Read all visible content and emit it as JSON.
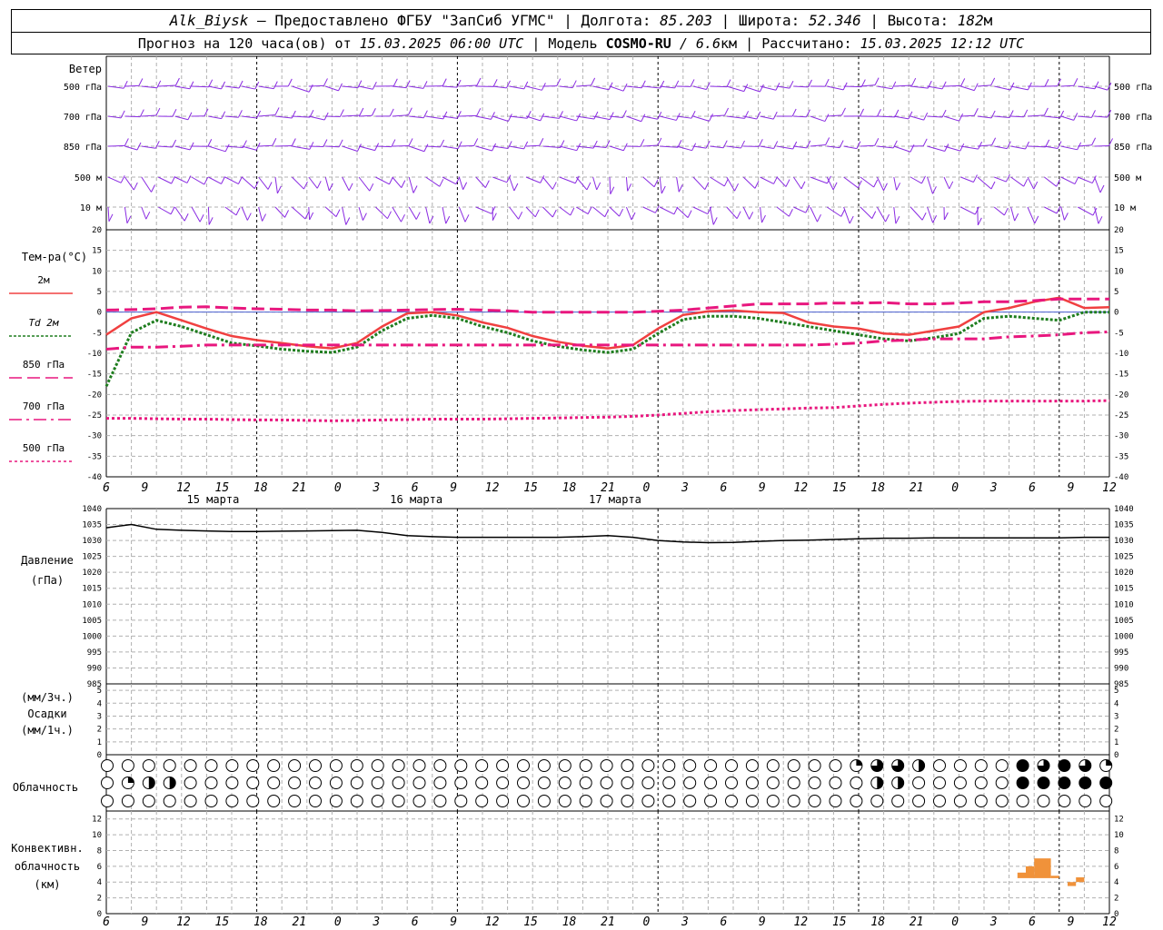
{
  "header": {
    "station": "Alk_Biysk",
    "provider": "— Предоставлено ФГБУ \"ЗапСиб УГМС\"",
    "lon_label": "Долгота:",
    "lon_value": "85.203",
    "lat_label": "Широта:",
    "lat_value": "52.346",
    "alt_label": "Высота:",
    "alt_value": "182",
    "alt_unit": "м",
    "forecast_label": "Прогноз на 120 часа(ов) от",
    "forecast_start": "15.03.2025 06:00 UTC",
    "model_label": "Модель",
    "model_name": "COSMO-RU",
    "model_res": "/ 6.6",
    "model_res_unit": "км",
    "computed_label": "Рассчитано:",
    "computed_time": "15.03.2025 12:12 UTC"
  },
  "wind": {
    "title": "Ветер",
    "levels": [
      "500 гПа",
      "700 гПа",
      "850 гПа",
      "500 м",
      "10 м"
    ],
    "color": "#8a2be2"
  },
  "temperature": {
    "title": "Тем-ра(°C)",
    "legend": [
      {
        "label": "2м",
        "color": "#f04040",
        "style": "solid"
      },
      {
        "label": "Td  2м",
        "color": "#1e7d1e",
        "style": "dotted"
      },
      {
        "label": "850 гПа",
        "color": "#e8177e",
        "style": "dash"
      },
      {
        "label": "700 гПа",
        "color": "#e8177e",
        "style": "dashdot"
      },
      {
        "label": "500 гПа",
        "color": "#e8177e",
        "style": "dot"
      }
    ],
    "y_ticks": [
      20,
      15,
      10,
      5,
      0,
      -5,
      -10,
      -15,
      -20,
      -25,
      -30,
      -35,
      -40
    ]
  },
  "time_axis": {
    "hour_labels": [
      "6",
      "9",
      "12",
      "15",
      "18",
      "21",
      "0",
      "3",
      "6",
      "9",
      "12",
      "15",
      "18",
      "21",
      "0",
      "3",
      "6",
      "9",
      "12",
      "15",
      "18",
      "21",
      "0",
      "3",
      "6",
      "9",
      "12"
    ],
    "day_labels": [
      "15 марта",
      "16 марта",
      "17 марта"
    ]
  },
  "pressure": {
    "title": "Давление",
    "unit": "(гПа)",
    "y_ticks": [
      1040,
      1035,
      1030,
      1025,
      1020,
      1015,
      1010,
      1005,
      1000,
      995,
      990,
      985
    ]
  },
  "precip": {
    "unit_top": "(мм/3ч.)",
    "title": "Осадки",
    "unit_bottom": "(мм/1ч.)",
    "y_ticks": [
      5,
      4,
      3,
      2,
      1,
      0
    ]
  },
  "cloud": {
    "title": "Облачность"
  },
  "convective": {
    "title_1": "Конвективн.",
    "title_2": "облачность",
    "unit": "(км)",
    "y_ticks": [
      12,
      10,
      8,
      6,
      4,
      2,
      0
    ],
    "color": "#f0923a"
  },
  "chart_data": [
    {
      "type": "line",
      "title": "Тем-ра(°C)",
      "x_hours": [
        0,
        3,
        6,
        9,
        12,
        15,
        18,
        21,
        24,
        27,
        30,
        33,
        36,
        39,
        42,
        45,
        48,
        51,
        54,
        57,
        60,
        63,
        66,
        69,
        72,
        75,
        78,
        81,
        84,
        87,
        90,
        93,
        96,
        99,
        102,
        105,
        108,
        111,
        114,
        117,
        120
      ],
      "ylim": [
        -40,
        20
      ],
      "series": [
        {
          "name": "2м",
          "values": [
            -5.5,
            -1.5,
            0,
            -2,
            -4,
            -5.8,
            -6.8,
            -7.5,
            -8.3,
            -8.8,
            -7.5,
            -3.5,
            -0.3,
            0,
            -0.8,
            -2.5,
            -3.8,
            -5.8,
            -7.2,
            -8.2,
            -8.8,
            -8,
            -4,
            -0.7,
            0.2,
            0.4,
            0,
            -0.2,
            -2.5,
            -3.5,
            -4,
            -5.2,
            -5.5,
            -4.5,
            -3.5,
            0,
            1,
            2.5,
            3.5,
            1,
            1.2
          ]
        },
        {
          "name": "Td  2м",
          "values": [
            -18,
            -5,
            -2,
            -3.5,
            -5.5,
            -7.5,
            -8.2,
            -9,
            -9.5,
            -9.8,
            -8.5,
            -4.5,
            -1.5,
            -0.8,
            -1.5,
            -3.5,
            -5,
            -7,
            -8.3,
            -9.2,
            -9.8,
            -9,
            -5.2,
            -1.8,
            -1,
            -1,
            -1.5,
            -2.5,
            -3.5,
            -4.5,
            -5.5,
            -6.5,
            -7,
            -6.2,
            -5.2,
            -1.5,
            -1,
            -1.5,
            -2,
            0,
            0
          ]
        },
        {
          "name": "850 гПа",
          "values": [
            0.5,
            0.6,
            0.8,
            1.2,
            1.3,
            1,
            0.8,
            0.7,
            0.5,
            0.5,
            0.3,
            0.4,
            0.5,
            0.6,
            0.7,
            0.5,
            0.3,
            0,
            0,
            0,
            0,
            0,
            0.2,
            0.5,
            1,
            1.5,
            2,
            2,
            2,
            2.2,
            2.2,
            2.3,
            2,
            2,
            2.2,
            2.5,
            2.5,
            2.8,
            3.2,
            3.2,
            3.2
          ]
        },
        {
          "name": "700 гПа",
          "values": [
            -9,
            -8.5,
            -8.5,
            -8.3,
            -8,
            -8,
            -8,
            -8,
            -8,
            -8,
            -8,
            -8,
            -8,
            -8,
            -8,
            -8,
            -8,
            -8,
            -8,
            -8,
            -8,
            -8,
            -8,
            -8,
            -8,
            -8,
            -8,
            -8,
            -8,
            -7.8,
            -7.5,
            -7,
            -6.8,
            -6.5,
            -6.5,
            -6.5,
            -6,
            -5.8,
            -5.5,
            -5,
            -4.8
          ]
        },
        {
          "name": "500 гПа",
          "values": [
            -25.8,
            -25.8,
            -25.9,
            -26,
            -26,
            -26.1,
            -26.2,
            -26.2,
            -26.3,
            -26.4,
            -26.3,
            -26.2,
            -26.1,
            -26,
            -26,
            -26,
            -25.9,
            -25.8,
            -25.7,
            -25.6,
            -25.5,
            -25.3,
            -25,
            -24.6,
            -24.2,
            -23.9,
            -23.7,
            -23.5,
            -23.3,
            -23.2,
            -22.8,
            -22.4,
            -22.1,
            -21.9,
            -21.7,
            -21.6,
            -21.6,
            -21.6,
            -21.6,
            -21.6,
            -21.5
          ]
        }
      ]
    },
    {
      "type": "line",
      "title": "Давление",
      "x_hours": [
        0,
        3,
        6,
        9,
        12,
        15,
        18,
        21,
        24,
        27,
        30,
        33,
        36,
        39,
        42,
        45,
        48,
        51,
        54,
        57,
        60,
        63,
        66,
        69,
        72,
        75,
        78,
        81,
        84,
        87,
        90,
        93,
        96,
        99,
        102,
        105,
        108,
        111,
        114,
        117,
        120
      ],
      "ylim": [
        985,
        1040
      ],
      "series": [
        {
          "name": "Давление",
          "values": [
            1034,
            1035,
            1033.5,
            1033.2,
            1033,
            1032.8,
            1032.8,
            1032.9,
            1033,
            1033.1,
            1033.2,
            1032.5,
            1031.5,
            1031.2,
            1031,
            1031,
            1031,
            1031,
            1031,
            1031.2,
            1031.5,
            1031,
            1030,
            1029.5,
            1029.3,
            1029.4,
            1029.7,
            1030,
            1030.1,
            1030.3,
            1030.5,
            1030.7,
            1030.7,
            1030.8,
            1030.8,
            1030.8,
            1030.8,
            1030.8,
            1030.8,
            1031,
            1031
          ]
        }
      ]
    },
    {
      "type": "bar",
      "title": "Конвективн. облачность",
      "ylim": [
        0,
        13
      ],
      "bars": [
        {
          "x_from": 109,
          "x_to": 110,
          "base": 4.5,
          "top": 5.2
        },
        {
          "x_from": 110,
          "x_to": 111,
          "base": 4.5,
          "top": 6
        },
        {
          "x_from": 111,
          "x_to": 113,
          "base": 4.5,
          "top": 7
        },
        {
          "x_from": 113,
          "x_to": 114,
          "base": 4.5,
          "top": 4.8
        },
        {
          "x_from": 115,
          "x_to": 116,
          "base": 3.5,
          "top": 4
        },
        {
          "x_from": 116,
          "x_to": 117,
          "base": 4,
          "top": 4.6
        }
      ]
    }
  ]
}
